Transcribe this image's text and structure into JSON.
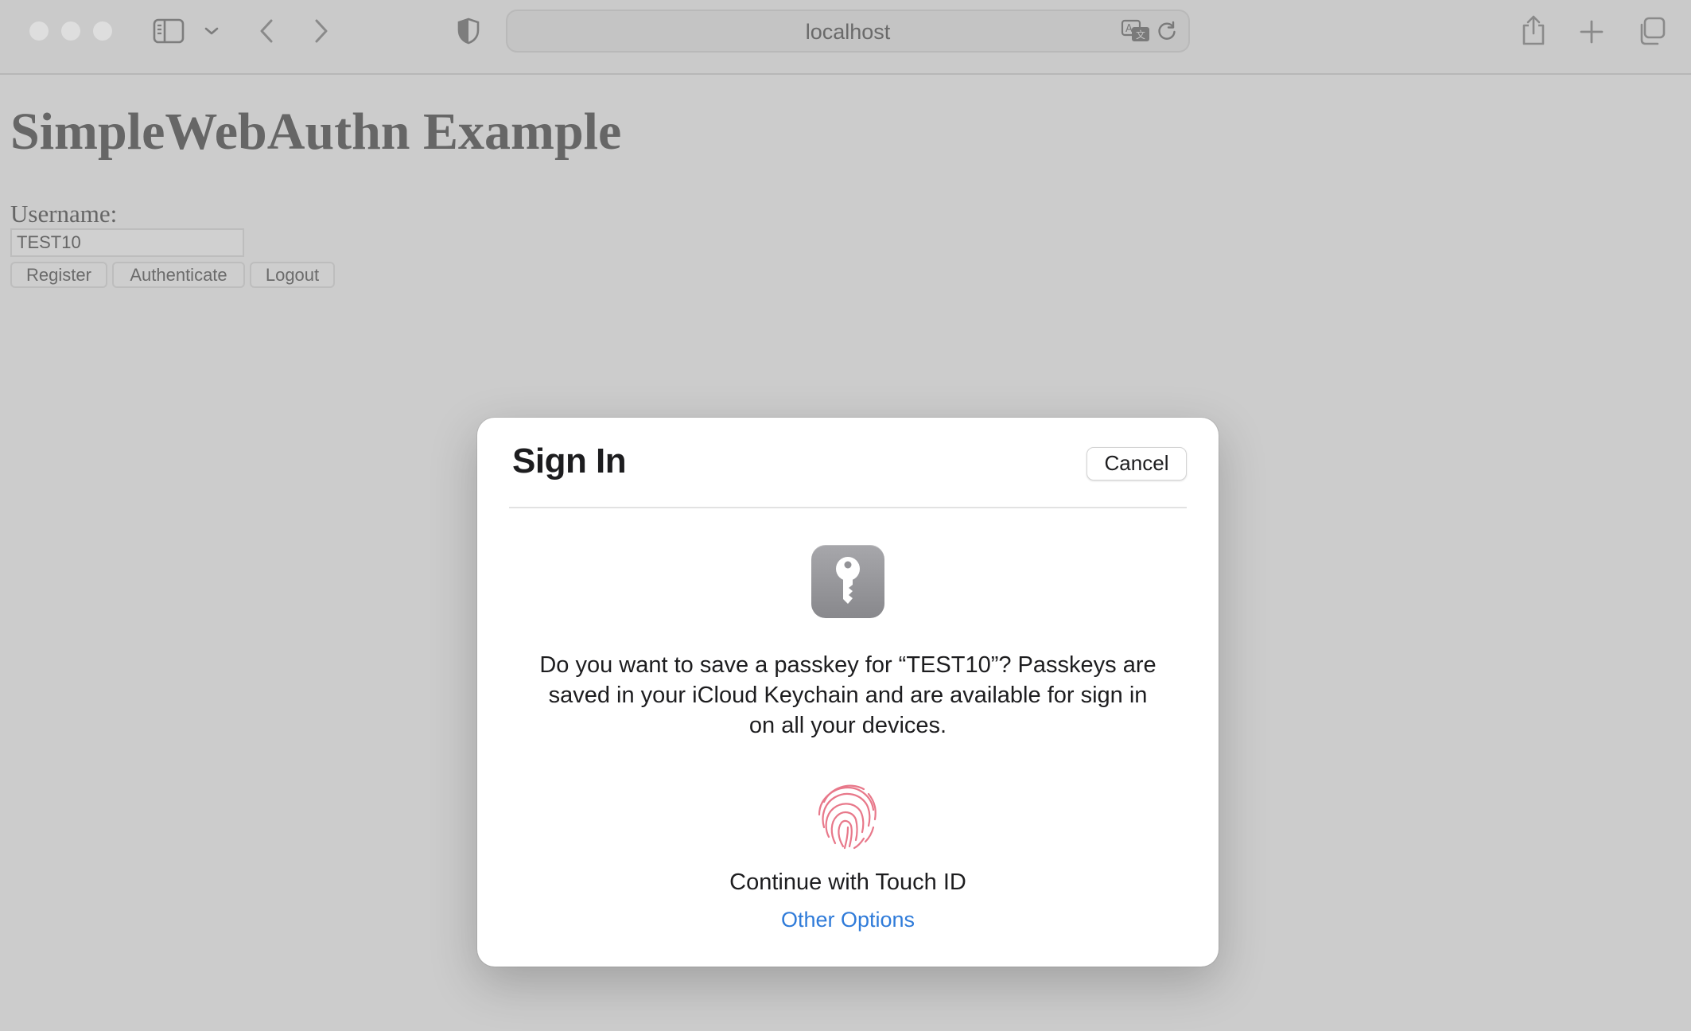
{
  "browser": {
    "address": "localhost",
    "colors": {
      "toolbar": "#cacaca",
      "accent_link": "#2f7bd9"
    }
  },
  "page": {
    "title": "SimpleWebAuthn Example",
    "username_label": "Username:",
    "username_value": "TEST10",
    "buttons": {
      "register": "Register",
      "authenticate": "Authenticate",
      "logout": "Logout"
    }
  },
  "dialog": {
    "title": "Sign In",
    "cancel_label": "Cancel",
    "message": "Do you want to save a passkey for “TEST10”? Passkeys are saved in your iCloud Keychain and are available for sign in on all your devices.",
    "touchid_label": "Continue with Touch ID",
    "other_options_label": "Other Options",
    "icons": {
      "app": "key-icon",
      "auth": "fingerprint-icon"
    }
  }
}
